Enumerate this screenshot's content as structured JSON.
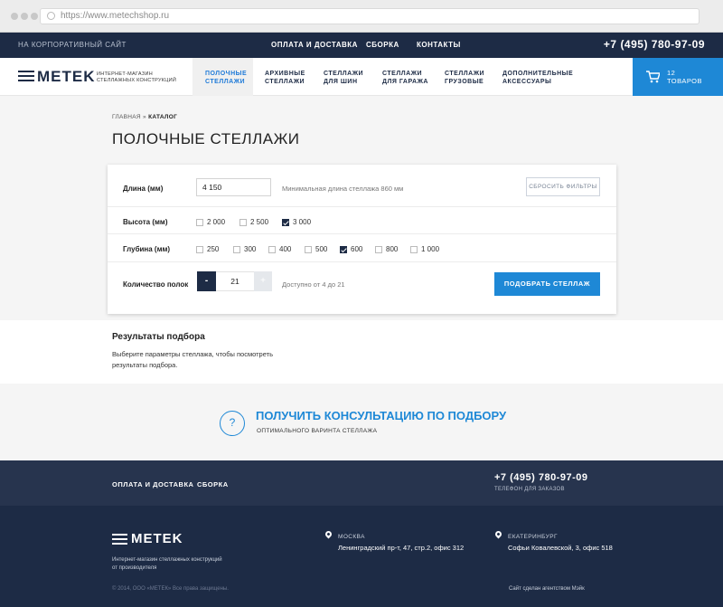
{
  "browser": {
    "url": "https://www.metechshop.ru"
  },
  "topbar": {
    "corporate": "НА КОРПОРАТИВНЫЙ САЙТ",
    "nav": [
      "ОПЛАТА И ДОСТАВКА",
      "СБОРКА",
      "КОНТАКТЫ"
    ],
    "phone": "+7 (495) 780-97-09"
  },
  "header": {
    "logo": "METEK",
    "tagline_1": "ИНТЕРНЕТ-МАГАЗИН",
    "tagline_2": "СТЕЛЛАЖНЫХ КОНСТРУКЦИЙ",
    "nav": [
      {
        "line1": "ПОЛОЧНЫЕ",
        "line2": "СТЕЛЛАЖИ",
        "active": true
      },
      {
        "line1": "АРХИВНЫЕ",
        "line2": "СТЕЛЛАЖИ",
        "active": false
      },
      {
        "line1": "СТЕЛЛАЖИ",
        "line2": "ДЛЯ ШИН",
        "active": false
      },
      {
        "line1": "СТЕЛЛАЖИ",
        "line2": "ДЛЯ ГАРАЖА",
        "active": false
      },
      {
        "line1": "СТЕЛЛАЖИ",
        "line2": "ГРУЗОВЫЕ",
        "active": false
      },
      {
        "line1": "ДОПОЛНИТЕЛЬНЫЕ",
        "line2": "АКСЕССУАРЫ",
        "active": false
      }
    ],
    "cart": {
      "count": "12",
      "label": "ТОВАРОВ"
    }
  },
  "breadcrumb": {
    "home": "ГЛАВНАЯ",
    "separator": "»",
    "current": "КАТАЛОГ"
  },
  "page_title": "ПОЛОЧНЫЕ СТЕЛЛАЖИ",
  "filter": {
    "length": {
      "label": "Длина (мм)",
      "value": "4 150",
      "hint": "Минимальная длина стеллажа 860 мм"
    },
    "reset_label": "СБРОСИТЬ ФИЛЬТРЫ",
    "height": {
      "label": "Высота (мм)",
      "options": [
        {
          "value": "2 000",
          "checked": false
        },
        {
          "value": "2 500",
          "checked": false
        },
        {
          "value": "3 000",
          "checked": true
        }
      ]
    },
    "depth": {
      "label": "Глубина (мм)",
      "options": [
        {
          "value": "250",
          "checked": false
        },
        {
          "value": "300",
          "checked": false
        },
        {
          "value": "400",
          "checked": false
        },
        {
          "value": "500",
          "checked": false
        },
        {
          "value": "600",
          "checked": true
        },
        {
          "value": "800",
          "checked": false
        },
        {
          "value": "1 000",
          "checked": false
        }
      ]
    },
    "shelves": {
      "label": "Количество полок",
      "minus": "-",
      "value": "21",
      "plus": "+",
      "hint": "Доступно от 4 до 21"
    },
    "submit_label": "ПОДОБРАТЬ СТЕЛЛАЖ"
  },
  "results": {
    "title": "Результаты подбора",
    "text": "Выберите параметры стеллажа, чтобы посмотреть результаты подбора."
  },
  "consult": {
    "icon_glyph": "?",
    "title": "ПОЛУЧИТЬ КОНСУЛЬТАЦИЮ ПО ПОДБОРУ",
    "subtitle": "ОПТИМАЛЬНОГО ВАРИНТА СТЕЛЛАЖА"
  },
  "footer": {
    "nav": [
      "ОПЛАТА И ДОСТАВКА",
      "СБОРКА"
    ],
    "phone": "+7 (495) 780-97-09",
    "phone_label": "ТЕЛЕФОН ДЛЯ ЗАКАЗОВ",
    "logo": "METEK",
    "tagline_1": "Интернет-магазин стеллажных конструкций",
    "tagline_2": "от производителя",
    "copyright": "© 2014, ООО «МЕТЕК» Все права защищены.",
    "offices": [
      {
        "city": "МОСКВА",
        "address": "Ленинградский пр-т, 47, стр.2, офис 312"
      },
      {
        "city": "ЕКАТЕРИНБУРГ",
        "address": "Софьи Ковалевской, 3, офис 518"
      }
    ],
    "credit": "Сайт сделан агентством Мэйк"
  },
  "colors": {
    "navy": "#1d2b45",
    "accent": "#1e88d6",
    "bg_gray": "#f5f5f5"
  }
}
